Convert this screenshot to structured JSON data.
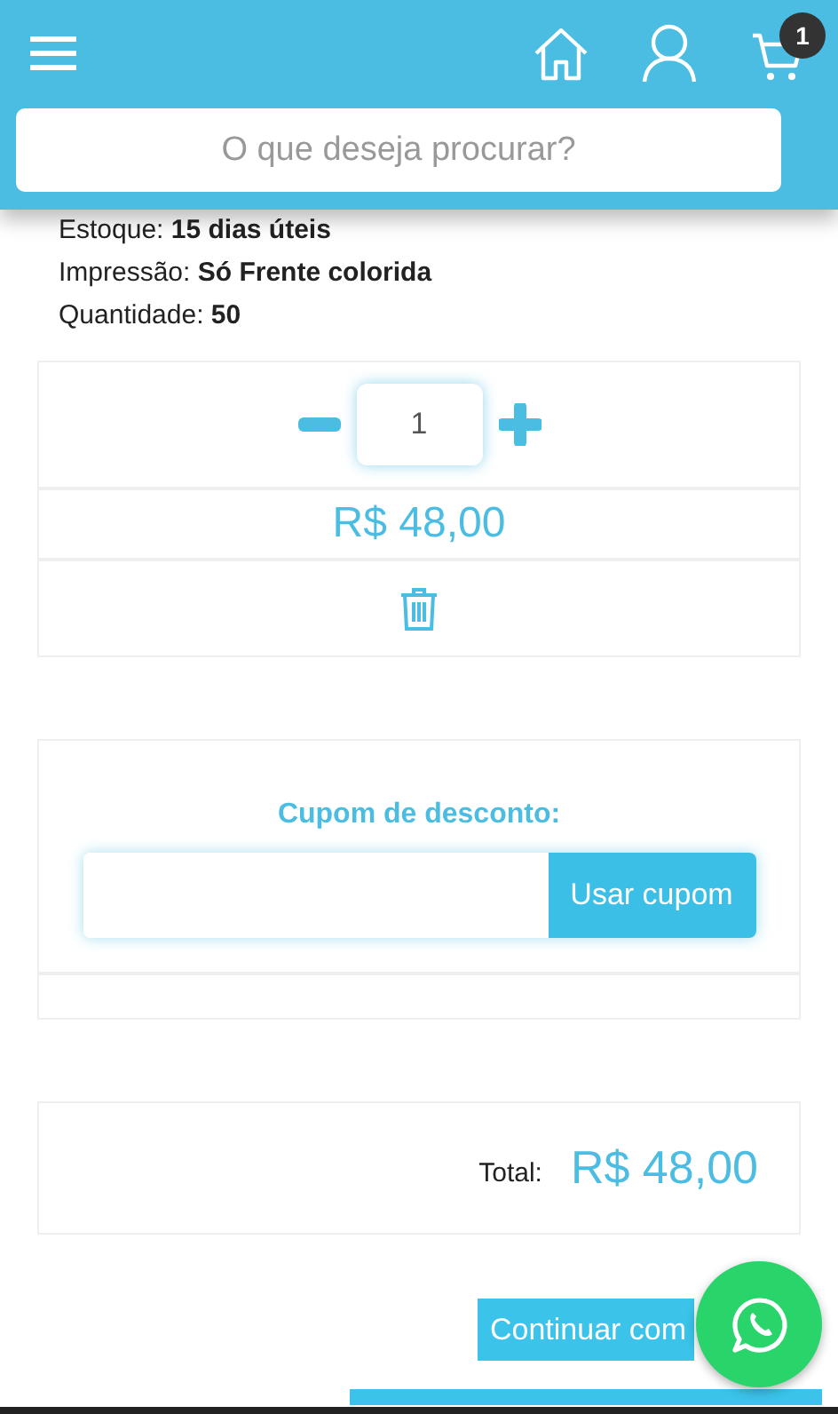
{
  "header": {
    "cart_count": "1"
  },
  "search": {
    "placeholder": "O que deseja procurar?"
  },
  "details": [
    {
      "label": "Estoque:",
      "value": "15 dias úteis"
    },
    {
      "label": "Impressão:",
      "value": "Só Frente colorida"
    },
    {
      "label": "Quantidade:",
      "value": "50"
    }
  ],
  "quantity": {
    "value": "1"
  },
  "price": "R$ 48,00",
  "coupon": {
    "label": "Cupom de desconto:",
    "button": "Usar cupom"
  },
  "total": {
    "label": "Total:",
    "value": "R$ 48,00"
  },
  "buttons": [
    {
      "kind": "continue",
      "label": "Continuar com"
    },
    {
      "kind": "checkout"
    }
  ]
}
